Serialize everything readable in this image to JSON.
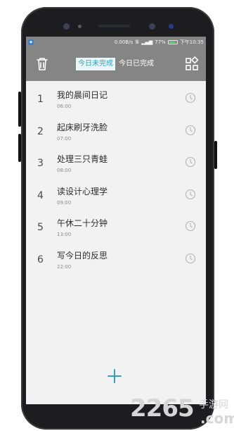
{
  "status_bar": {
    "speed": "0.00B/s",
    "battery": "77%",
    "battery_level": 0.77,
    "time": "下午10:35"
  },
  "toolbar": {
    "tabs": [
      {
        "label": "今日未完成",
        "active": true
      },
      {
        "label": "今日已完成",
        "active": false
      }
    ],
    "left_icon": "trash-icon",
    "right_icon": "grid-icon"
  },
  "tasks": [
    {
      "num": "1",
      "title": "我的晨间日记",
      "time": "06:00"
    },
    {
      "num": "2",
      "title": "起床刷牙洗脸",
      "time": "07:00"
    },
    {
      "num": "3",
      "title": "处理三只青蛙",
      "time": "08:00"
    },
    {
      "num": "4",
      "title": "读设计心理学",
      "time": "09:00"
    },
    {
      "num": "5",
      "title": "午休二十分钟",
      "time": "13:00"
    },
    {
      "num": "6",
      "title": "写今日的反思",
      "time": "22:00"
    }
  ],
  "add_icon": "plus-icon",
  "colors": {
    "toolbar_bg": "#858585",
    "accent": "#2ea3bd",
    "screen_bg": "#f2f2f2"
  },
  "watermark": {
    "big": "2265",
    "cn": "手游网",
    "com": ".com"
  }
}
